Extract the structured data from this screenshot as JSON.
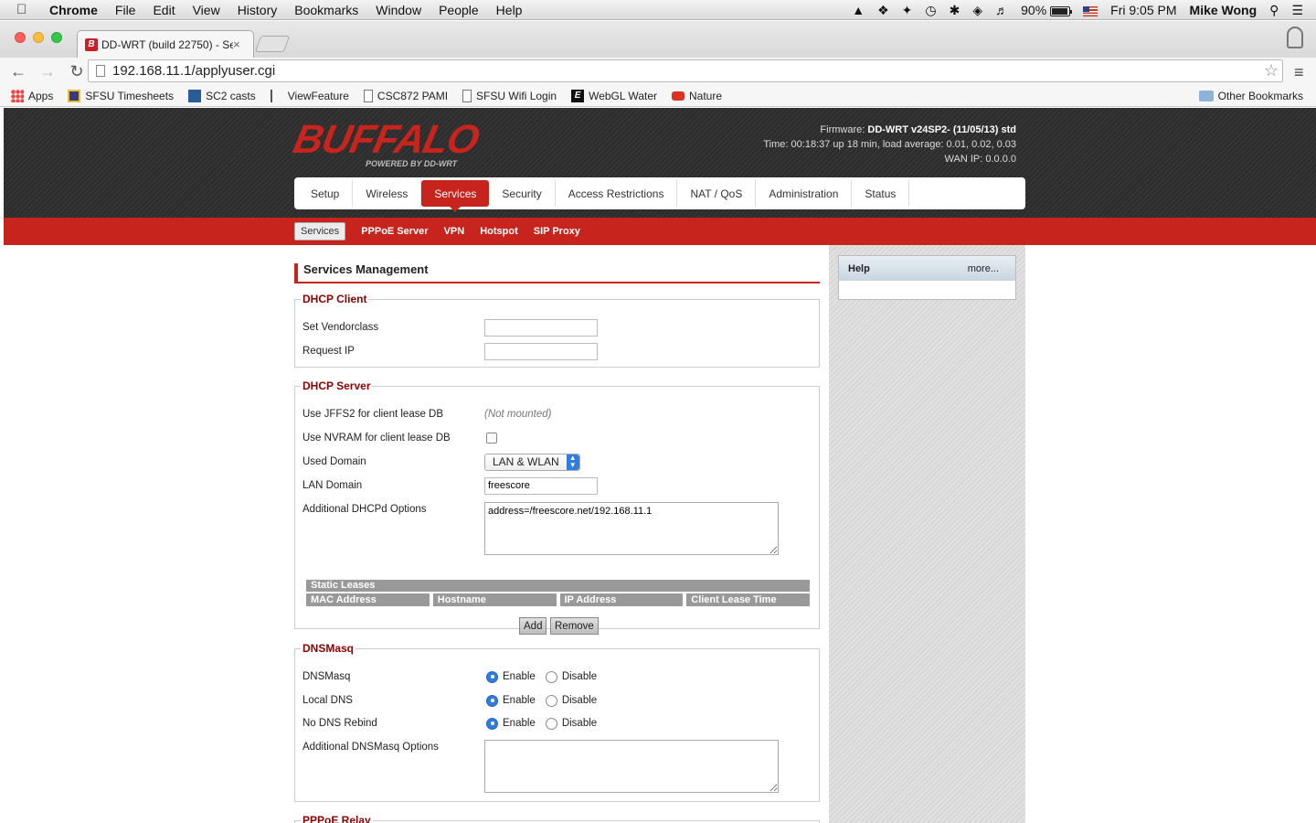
{
  "menubar": {
    "app": "Chrome",
    "items": [
      "File",
      "Edit",
      "View",
      "History",
      "Bookmarks",
      "Window",
      "People",
      "Help"
    ],
    "battery": "90%",
    "clock": "Fri 9:05 PM",
    "user": "Mike Wong"
  },
  "browser": {
    "tab_title": "DD-WRT (build 22750) - Se",
    "url": "192.168.11.1/applyuser.cgi",
    "bookmarks": [
      "Apps",
      "SFSU Timesheets",
      "SC2 casts",
      "ViewFeature",
      "CSC872 PAMI",
      "SFSU Wifi Login",
      "WebGL Water",
      "Nature"
    ],
    "other_bookmarks": "Other Bookmarks"
  },
  "header": {
    "logo": "BUFFALO",
    "logo_tagline": "POWERED BY DD-WRT",
    "firmware_label": "Firmware:",
    "firmware": "DD-WRT v24SP2- (11/05/13) std",
    "time_label": "Time:",
    "time": "00:18:37 up 18 min, load average: 0.01, 0.02, 0.03",
    "wan_label": "WAN IP:",
    "wan_ip": "0.0.0.0"
  },
  "nav": {
    "tabs": [
      "Setup",
      "Wireless",
      "Services",
      "Security",
      "Access Restrictions",
      "NAT / QoS",
      "Administration",
      "Status"
    ],
    "active": "Services",
    "subtabs": [
      "Services",
      "PPPoE Server",
      "VPN",
      "Hotspot",
      "SIP Proxy"
    ]
  },
  "content": {
    "title": "Services Management",
    "dhcp_client": {
      "legend": "DHCP Client",
      "vendorclass_label": "Set Vendorclass",
      "vendorclass_value": "",
      "request_ip_label": "Request IP",
      "request_ip_value": ""
    },
    "dhcp_server": {
      "legend": "DHCP Server",
      "jffs2_label": "Use JFFS2 for client lease DB",
      "jffs2_value": "(Not mounted)",
      "nvram_label": "Use NVRAM for client lease DB",
      "nvram_checked": false,
      "used_domain_label": "Used Domain",
      "used_domain_value": "LAN & WLAN",
      "lan_domain_label": "LAN Domain",
      "lan_domain_value": "freescore",
      "additional_label": "Additional DHCPd Options",
      "additional_value": "address=/freescore.net/192.168.11.1",
      "static_leases": "Static Leases",
      "lease_columns": [
        "MAC Address",
        "Hostname",
        "IP Address",
        "Client Lease Time"
      ],
      "add_button": "Add",
      "remove_button": "Remove"
    },
    "dnsmasq": {
      "legend": "DNSMasq",
      "enable_label": "Enable",
      "disable_label": "Disable",
      "dnsmasq_label": "DNSMasq",
      "local_dns_label": "Local DNS",
      "no_rebind_label": "No DNS Rebind",
      "options_label": "Additional DNSMasq Options",
      "options_value": ""
    },
    "pppoe_relay_legend": "PPPoE Relay"
  },
  "help": {
    "title": "Help",
    "more": "more..."
  },
  "colors": {
    "brand_red": "#c8241e",
    "legend_red": "#8b0000",
    "radio_blue": "#2f7de0"
  }
}
